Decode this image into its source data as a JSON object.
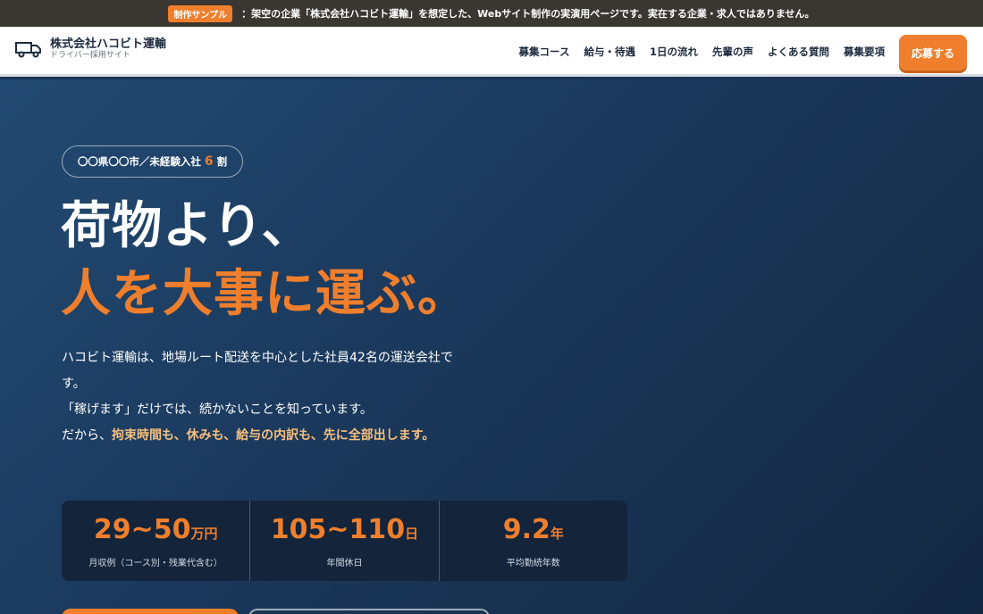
{
  "notice": {
    "badge": "制作サンプル",
    "text": "：架空の企業「株式会社ハコビト運輸」を想定した、Webサイト制作の実演用ページです。実在する企業・求人ではありません。"
  },
  "header": {
    "logo_icon": "truck-icon",
    "company": "株式会社ハコビト運輸",
    "subtitle": "ドライバー採用サイト",
    "nav": [
      "募集コース",
      "給与・待遇",
      "1日の流れ",
      "先輩の声",
      "よくある質問",
      "募集要項"
    ],
    "apply_label": "応募する"
  },
  "hero": {
    "pill_prefix": "〇〇県〇〇市／未経験入社",
    "pill_num": "6",
    "pill_suffix": "割",
    "title_line1": "荷物より、",
    "title_line2": "人を大事に運ぶ。",
    "lead_1": "ハコビト運輸は、地場ルート配送を中心とした社員42名の運送会社です。",
    "lead_2": "「稼げます」だけでは、続かないことを知っています。",
    "lead_3": "だから、",
    "lead_3_highlight": "拘束時間も、休みも、給与の内訳も、先に全部出します。"
  },
  "stats": [
    {
      "value": "29~50",
      "unit": "万円",
      "label": "月収例（コース別・残業代含む）"
    },
    {
      "value": "105~110",
      "unit": "日",
      "label": "年間休日"
    },
    {
      "value": "9.2",
      "unit": "年",
      "label": "平均勤続年数"
    }
  ],
  "colors": {
    "accent": "#ef7f2c",
    "navy": "#1b3456",
    "highlight": "#f6bf7d"
  }
}
